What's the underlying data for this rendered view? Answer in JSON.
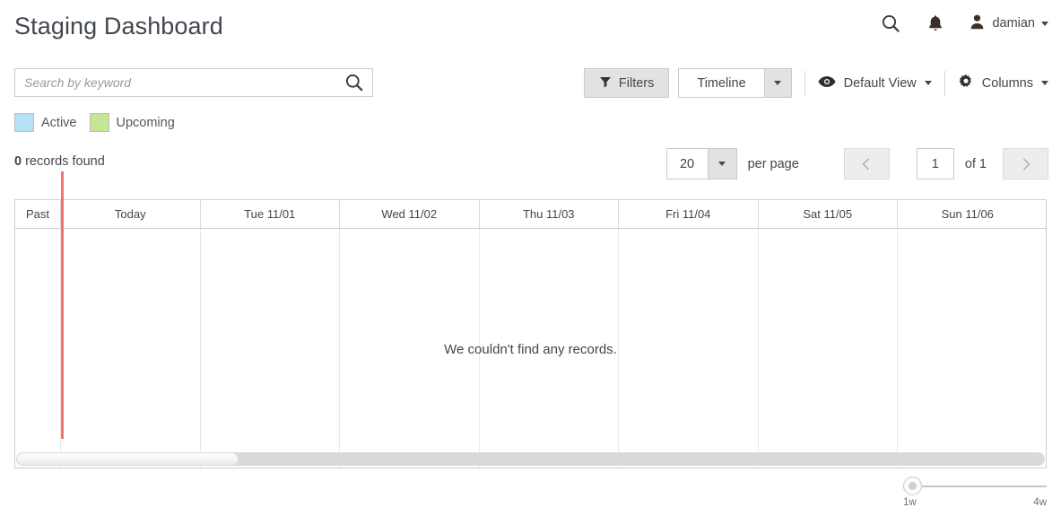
{
  "header": {
    "title": "Staging Dashboard",
    "search_icon": "search-icon",
    "bell_icon": "bell-icon",
    "user_icon": "user-icon",
    "username": "damian"
  },
  "search": {
    "placeholder": "Search by keyword",
    "value": "",
    "icon": "search-icon"
  },
  "toolbar": {
    "filters_label": "Filters",
    "filters_icon": "funnel-icon",
    "timeline_label": "Timeline",
    "timeline_arrow_icon": "chevron-down-icon",
    "view_icon": "eye-icon",
    "view_label": "Default View",
    "columns_icon": "gear-icon",
    "columns_label": "Columns"
  },
  "legend": {
    "items": [
      {
        "label": "Active",
        "color": "#b5e3f5"
      },
      {
        "label": "Upcoming",
        "color": "#c5e793"
      }
    ]
  },
  "results": {
    "count": "0",
    "count_suffix": " records found"
  },
  "pagination": {
    "per_page_value": "20",
    "per_page_label": "per page",
    "prev_icon": "chevron-left-icon",
    "next_icon": "chevron-right-icon",
    "page_value": "1",
    "of_label": "of 1"
  },
  "timeline": {
    "columns": [
      "Past",
      "Today",
      "Tue 11/01",
      "Wed 11/02",
      "Thu 11/03",
      "Fri 11/04",
      "Sat 11/05",
      "Sun 11/06"
    ],
    "now_marker_color": "#f47272",
    "empty_message": "We couldn't find any records."
  },
  "zoom_slider": {
    "min_label": "1w",
    "max_label": "4w"
  }
}
